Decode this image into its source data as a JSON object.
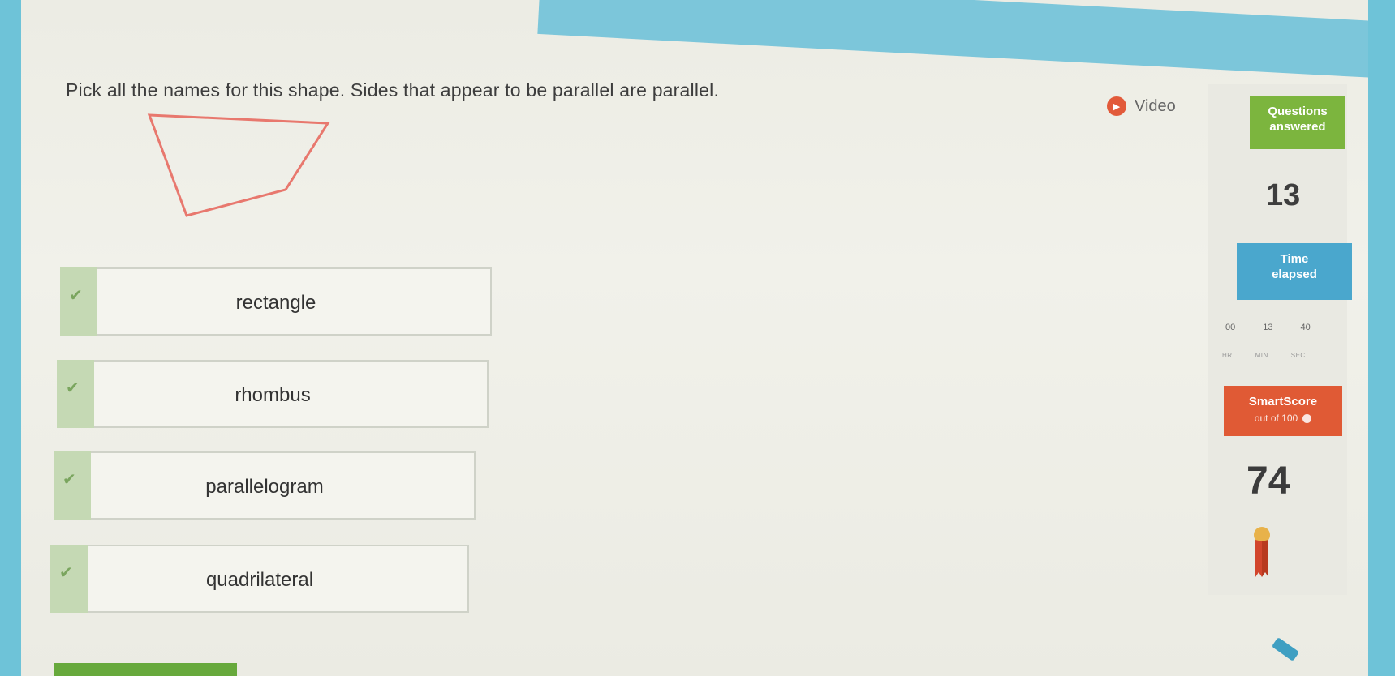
{
  "question": {
    "text": "Pick all the names for this shape. Sides that appear to be parallel are parallel."
  },
  "shape": {
    "stroke_color": "#e8786e"
  },
  "choices": [
    {
      "label": "rectangle"
    },
    {
      "label": "rhombus"
    },
    {
      "label": "parallelogram"
    },
    {
      "label": "quadrilateral"
    }
  ],
  "video": {
    "label": "Video",
    "icon": "play-icon"
  },
  "sidebar": {
    "questions_answered": {
      "title": "Questions",
      "subtitle": "answered",
      "value": "13",
      "color": "#7cb53e"
    },
    "time_elapsed": {
      "title": "Time",
      "subtitle": "elapsed",
      "hours": "00",
      "minutes": "13",
      "seconds": "40",
      "unit_hr": "HR",
      "unit_min": "MIN",
      "unit_sec": "SEC",
      "color": "#4aa7cd"
    },
    "smartscore": {
      "title": "SmartScore",
      "subtitle": "out of 100",
      "value": "74",
      "color": "#e05a35"
    },
    "award_icon": "ribbon-icon"
  }
}
